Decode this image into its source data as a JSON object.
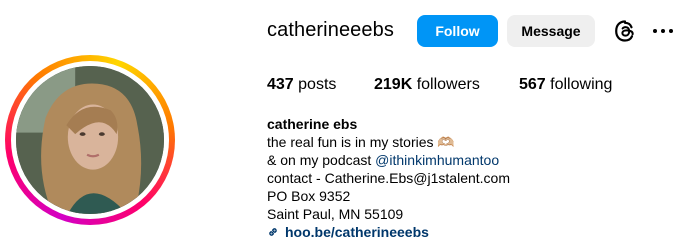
{
  "profile": {
    "username": "catherineeebs",
    "follow_label": "Follow",
    "message_label": "Message",
    "stats": {
      "posts_count": "437",
      "posts_label": "posts",
      "followers_count": "219K",
      "followers_label": "followers",
      "following_count": "567",
      "following_label": "following"
    },
    "bio": {
      "name": "catherine ebs",
      "line1": "the real fun is in my stories 🫶🏼",
      "line2_prefix": "& on my podcast ",
      "line2_mention": "@ithinkimhumantoo",
      "line3": "contact - Catherine.Ebs@j1stalent.com",
      "line4": "PO Box 9352",
      "line5": "Saint Paul, MN 55109",
      "link": "hoo.be/catherineeebs"
    }
  },
  "icons": {
    "threads": "threads-icon",
    "more": "more-options-icon",
    "link": "link-icon"
  },
  "colors": {
    "follow_button": "#0095f6",
    "message_button": "#efefef",
    "link_text": "#00376b"
  }
}
